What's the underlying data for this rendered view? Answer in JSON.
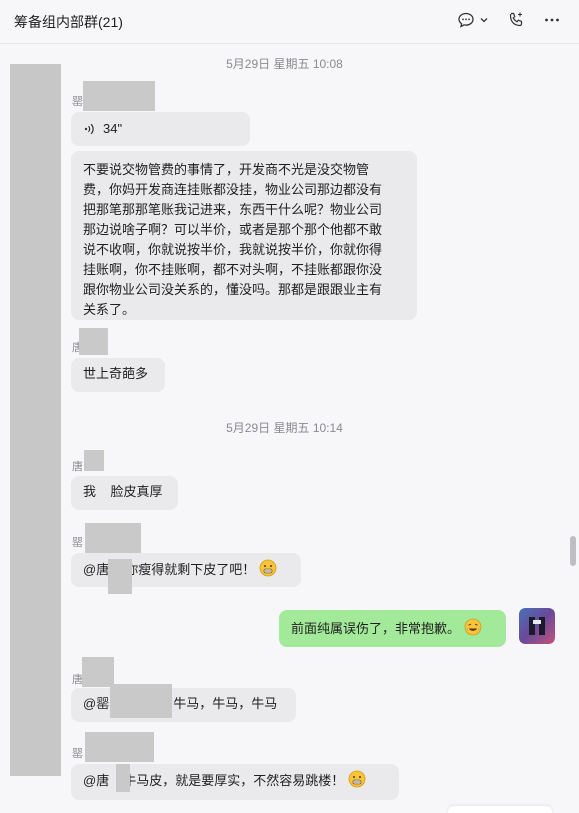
{
  "window": {
    "title": "筹备组内部群(21)",
    "icons": [
      "chat-bubble-icon",
      "chevron-down-icon",
      "phone-icon",
      "more-icon"
    ]
  },
  "timestamps": [
    "5月29日 星期五 10:08",
    "5月29日 星期五 10:14"
  ],
  "senders": {
    "s1": "罂",
    "s2": "唐",
    "s3": "唐",
    "s4": "罂",
    "s5": "唐",
    "s6": "罂"
  },
  "messages": {
    "m1_voice": "34\"",
    "m2_text": [
      "不要说交物管费的事情了，开发商不光是没交物管",
      "费，你妈开发商连挂账都没挂，物业公司那边都没有",
      "把那笔那那笔账我记进来，东西干什么呢？物业公司",
      "那边说啥子啊？可以半价，或者是那个那个他都不敢",
      "说不收啊，你就说按半价，我就说按半价，你就你得",
      "挂账啊，你不挂账啊，都不对头啊，不挂账都跟你没",
      "跟你物业公司没关系的，懂没吗。那都是跟跟业主有",
      "关系了。"
    ],
    "m3_text": "世上奇葩多",
    "m4_text": "我    脸皮真厚",
    "m5_prefix": "@唐",
    "m5_text": "你瘦得就剩下皮了吧！",
    "m6_text": "前面纯属误伤了，非常抱歉。",
    "m7_prefix": "@罂",
    "m7_text": "牛马，牛马，牛马",
    "m8_prefix": "@唐",
    "m8_text": "牛马皮，就是要厚实，不然容易跳楼！"
  },
  "colors": {
    "bubble_other": "#eaeaed",
    "bubble_self": "#a3e99a",
    "background": "#f7f7f9"
  }
}
